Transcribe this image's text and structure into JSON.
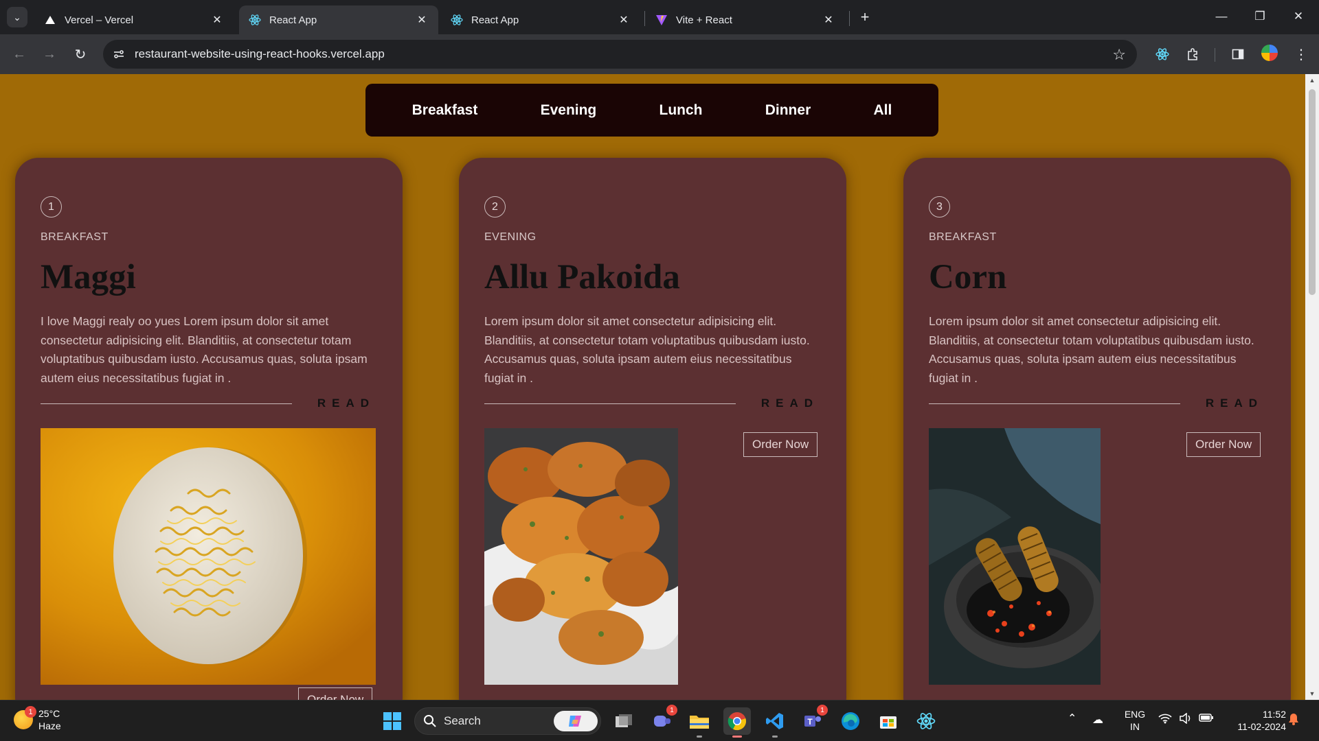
{
  "browser": {
    "tabs": [
      {
        "title": "Vercel – Vercel",
        "favicon": "vercel-triangle-icon",
        "active": false
      },
      {
        "title": "React App",
        "favicon": "react-icon",
        "active": true
      },
      {
        "title": "React App",
        "favicon": "react-icon",
        "active": false
      },
      {
        "title": "Vite + React",
        "favicon": "vite-icon",
        "active": false
      }
    ],
    "url": "restaurant-website-using-react-hooks.vercel.app"
  },
  "page": {
    "menu": [
      "Breakfast",
      "Evening",
      "Lunch",
      "Dinner",
      "All"
    ],
    "cards": [
      {
        "id": "1",
        "category": "BREAKFAST",
        "name": "Maggi",
        "description": "I love Maggi realy oo yues Lorem ipsum dolor sit amet consectetur adipisicing elit. Blanditiis, at consectetur totam voluptatibus quibusdam iusto. Accusamus quas, soluta ipsam autem eius necessitatibus fugiat in .",
        "read_label": "READ",
        "order_label": "Order Now",
        "image": "maggi-noodles-plate"
      },
      {
        "id": "2",
        "category": "EVENING",
        "name": "Allu Pakoida",
        "description": "Lorem ipsum dolor sit amet consectetur adipisicing elit. Blanditiis, at consectetur totam voluptatibus quibusdam iusto. Accusamus quas, soluta ipsam autem eius necessitatibus fugiat in .",
        "read_label": "READ",
        "order_label": "Order Now",
        "image": "fried-pakoras-basket"
      },
      {
        "id": "3",
        "category": "BREAKFAST",
        "name": "Corn",
        "description": "Lorem ipsum dolor sit amet consectetur adipisicing elit. Blanditiis, at consectetur totam voluptatibus quibusdam iusto. Accusamus quas, soluta ipsam autem eius necessitatibus fugiat in .",
        "read_label": "READ",
        "order_label": "Order Now",
        "image": "roasted-corn-on-coals"
      }
    ],
    "colors": {
      "background": "#a06a06",
      "card": "#5c3032",
      "menu": "#1a0505"
    }
  },
  "taskbar": {
    "weather": {
      "temp": "25°C",
      "condition": "Haze",
      "badge": "1"
    },
    "search_label": "Search",
    "badges": {
      "teams_meet": "1",
      "teams": "1"
    },
    "lang": {
      "line1": "ENG",
      "line2": "IN"
    },
    "clock": {
      "time": "11:52",
      "date": "11-02-2024"
    }
  }
}
